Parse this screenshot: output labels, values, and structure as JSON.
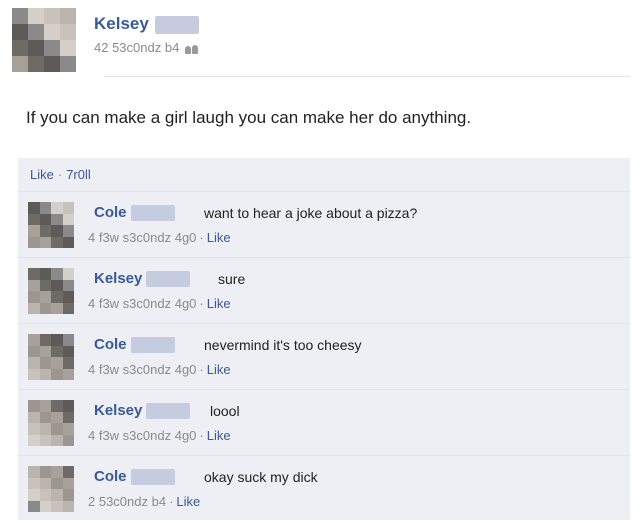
{
  "post": {
    "author": "Kelsey",
    "meta": "42 53c0ndz b4",
    "privacy_icon": "friends-icon",
    "text": "If you can make a girl laugh you can make her do anything."
  },
  "feedback": {
    "like_label": "Like",
    "separator": "·",
    "count": "7r0ll"
  },
  "comments": [
    {
      "author": "Cole",
      "text": "want to hear a joke about a pizza?",
      "time": "4 f3w s3c0ndz 4g0",
      "like_label": "Like"
    },
    {
      "author": "Kelsey",
      "text": "sure",
      "time": "4 f3w s3c0ndz 4g0",
      "like_label": "Like"
    },
    {
      "author": "Cole",
      "text": "nevermind it's too cheesy",
      "time": "4 f3w s3c0ndz 4g0",
      "like_label": "Like"
    },
    {
      "author": "Kelsey",
      "text": "loool",
      "time": "4 f3w s3c0ndz 4g0",
      "like_label": "Like"
    },
    {
      "author": "Cole",
      "text": "okay suck my dick",
      "time": "2 53c0ndz b4",
      "like_label": "Like"
    }
  ],
  "colors": {
    "link": "#3b5998",
    "meta": "#8a8a8a",
    "panel": "#edeff4"
  }
}
